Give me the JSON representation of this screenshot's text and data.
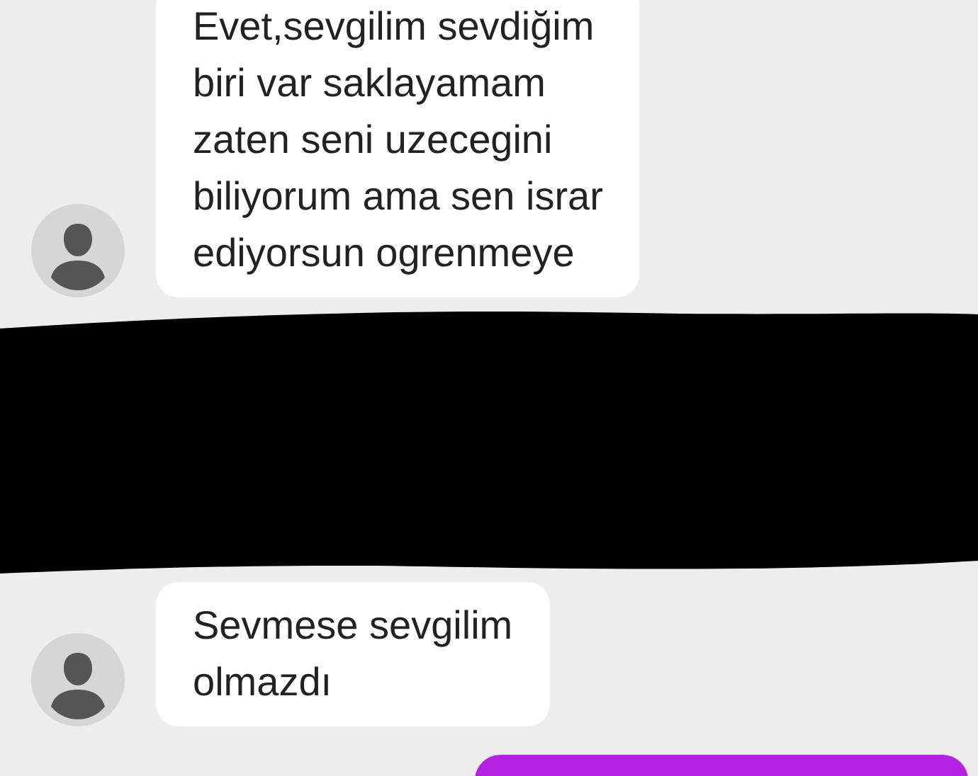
{
  "messages": [
    {
      "kind": "incoming",
      "text": "Evet,sevgilim sevdiğim\nbiri var saklayamam\nzaten seni uzecegini\nbiliyorum ama sen israr\nediyorsun ogrenmeye"
    },
    {
      "kind": "redaction"
    },
    {
      "kind": "incoming",
      "text": "Sevmese sevgilim\nolmazdı"
    },
    {
      "kind": "outgoing"
    }
  ]
}
